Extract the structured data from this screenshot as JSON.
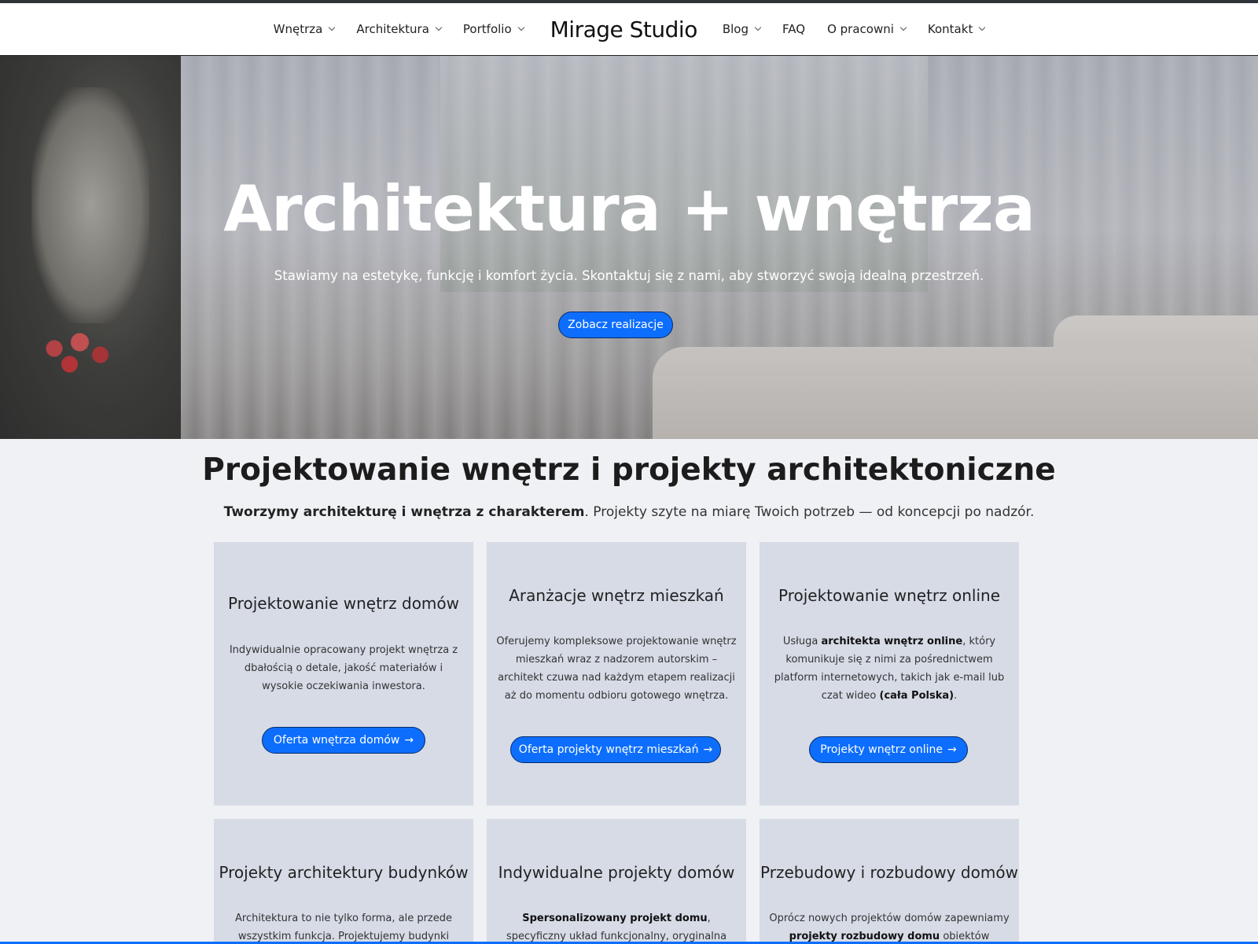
{
  "nav": {
    "items_left": [
      {
        "label": "Wnętrza"
      },
      {
        "label": "Architektura"
      },
      {
        "label": "Portfolio"
      }
    ],
    "brand": "Mirage Studio",
    "items_right": [
      {
        "label": "Blog",
        "dropdown": true
      },
      {
        "label": "FAQ",
        "dropdown": false
      },
      {
        "label": "O pracowni",
        "dropdown": true
      },
      {
        "label": "Kontakt",
        "dropdown": true
      }
    ]
  },
  "hero": {
    "title": "Architektura + wnętrza",
    "subtitle": "Stawiamy na estetykę, funkcję i komfort życia. Skontaktuj się z nami, aby stworzyć swoją idealną przestrzeń.",
    "button": "Zobacz realizacje"
  },
  "section": {
    "title": "Projektowanie wnętrz i projekty architektoniczne",
    "lead_bold": "Tworzymy architekturę i wnętrza z charakterem",
    "lead_rest": ". Projekty szyte na miarę Twoich potrzeb — od koncepcji po nadzór."
  },
  "cards": [
    {
      "title": "Projektowanie wnętrz domów",
      "text": "Indywidualnie opracowany projekt wnętrza z dbałością o detale, jakość materiałów i wysokie oczekiwania inwestora.",
      "button": "Oferta wnętrza domów"
    },
    {
      "title": "Aranżacje wnętrz mieszkań",
      "text": "Oferujemy kompleksowe projektowanie wnętrz mieszkań wraz z nadzorem autorskim – architekt czuwa nad każdym etapem realizacji aż do momentu odbioru gotowego wnętrza.",
      "button": "Oferta projekty wnętrz mieszkań"
    },
    {
      "title": "Projektowanie wnętrz online",
      "text_1": "Usługa ",
      "text_bold_1": "architekta wnętrz online",
      "text_2": ", który komunikuje się z nimi za pośrednictwem platform internetowych, takich jak e-mail lub czat wideo ",
      "text_bold_2": "(cała Polska)",
      "text_3": ".",
      "button": "Projekty wnętrz online"
    },
    {
      "title": "Projekty architektury budynków",
      "text": "Architektura to nie tylko forma, ale przede wszystkim funkcja. Projektujemy budynki"
    },
    {
      "title": "Indywidualne projekty domów",
      "text_bold_1": "Spersonalizowany projekt domu",
      "text_2": ", specyficzny układ funkcjonalny, oryginalna architektura"
    },
    {
      "title": "Przebudowy i rozbudowy domów",
      "text_1": "Oprócz nowych projektów domów zapewniamy ",
      "text_bold_1": "projekty rozbudowy domu",
      "text_2": " obiektów"
    }
  ],
  "colors": {
    "accent": "#0d6efd",
    "card_bg": "#d6dbe6",
    "page_bg": "#f0f1f5"
  },
  "icons": {
    "dropdown": "chevron-down-icon",
    "button_arrow": "arrow-right-icon"
  }
}
